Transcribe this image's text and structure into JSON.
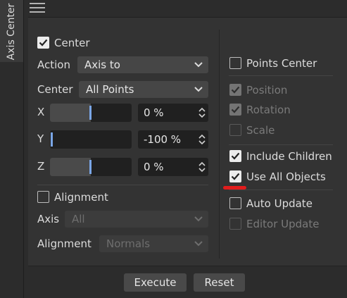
{
  "tab": {
    "label": "Axis Center"
  },
  "center_section": {
    "checkbox_label": "Center",
    "checked": true,
    "action_label": "Action",
    "action_value": "Axis to",
    "center_label": "Center",
    "center_value": "All Points"
  },
  "coords": [
    {
      "axis": "X",
      "value": "0 %",
      "level": 0.5
    },
    {
      "axis": "Y",
      "value": "-100 %",
      "level": 0.0
    },
    {
      "axis": "Z",
      "value": "0 %",
      "level": 0.5
    }
  ],
  "alignment_section": {
    "checkbox_label": "Alignment",
    "checked": false,
    "axis_label": "Axis",
    "axis_value": "All",
    "alignment_label": "Alignment",
    "alignment_value": "Normals"
  },
  "right_options": {
    "points_center": {
      "label": "Points Center",
      "checked": false,
      "enabled": true
    },
    "position": {
      "label": "Position",
      "checked": true,
      "enabled": false
    },
    "rotation": {
      "label": "Rotation",
      "checked": true,
      "enabled": false
    },
    "scale": {
      "label": "Scale",
      "checked": false,
      "enabled": false
    },
    "include_children": {
      "label": "Include Children",
      "checked": true,
      "enabled": true
    },
    "use_all_objects": {
      "label": "Use All Objects",
      "checked": true,
      "enabled": true
    },
    "auto_update": {
      "label": "Auto Update",
      "checked": false,
      "enabled": true
    },
    "editor_update": {
      "label": "Editor Update",
      "checked": false,
      "enabled": false
    }
  },
  "buttons": {
    "execute": "Execute",
    "reset": "Reset"
  },
  "colors": {
    "accent_knob": "#7aa6e6",
    "annotation_mark": "#e21c1c"
  }
}
